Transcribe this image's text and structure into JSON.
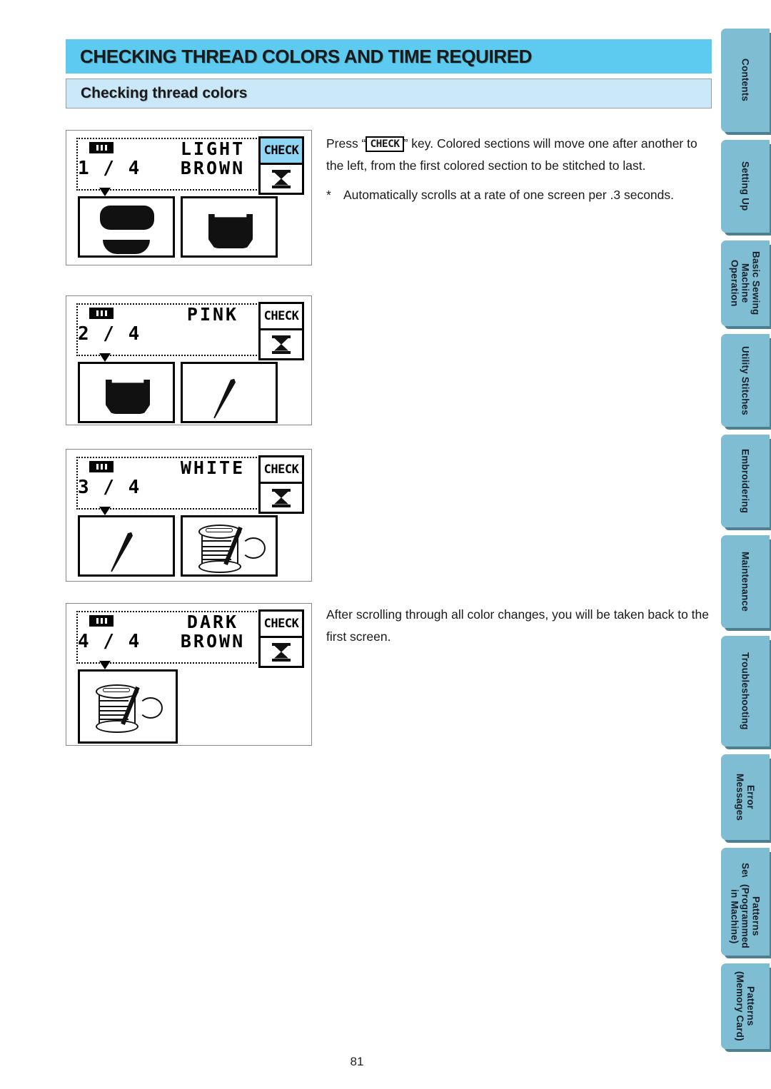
{
  "header": {
    "title": "CHECKING THREAD COLORS AND TIME REQUIRED",
    "section": "Checking thread colors",
    "title_bg": "#5ccbef",
    "section_bg": "#cbe8f9"
  },
  "paragraphs": {
    "p1_before": "Press “",
    "p1_key": "CHECK",
    "p1_after": "” key.  Colored sections will move one after another to the left, from the first colored section to be stitched to last.",
    "p2_marker": "*",
    "p2_text": "Automatically scrolls at a rate of one screen per .3 seconds.",
    "p3_text": "After scrolling through all color changes, you will be taken back to the first screen."
  },
  "lcd_screens": [
    {
      "index": "1",
      "fraction": "1 / 4",
      "color_name": "LIGHT\nBROWN",
      "check_label": "CHECK",
      "check_highlighted": true,
      "thumbnails": [
        "oval-and-arc-shape",
        "cup-shape"
      ]
    },
    {
      "index": "2",
      "fraction": "2 / 4",
      "color_name": "PINK",
      "check_label": "CHECK",
      "check_highlighted": false,
      "thumbnails": [
        "cup-shape",
        "needle-shape"
      ]
    },
    {
      "index": "3",
      "fraction": "3 / 4",
      "color_name": "WHITE",
      "check_label": "CHECK",
      "check_highlighted": false,
      "thumbnails": [
        "needle-shape",
        "spool-and-needle-shape"
      ]
    },
    {
      "index": "4",
      "fraction": "4 / 4",
      "color_name": "DARK\nBROWN",
      "check_label": "CHECK",
      "check_highlighted": false,
      "thumbnails": [
        "spool-and-needle-shape"
      ]
    }
  ],
  "side_tabs": [
    {
      "label": "Contents"
    },
    {
      "label": "Setting Up"
    },
    {
      "label": "Basic Sewing\nMachine\nOperation"
    },
    {
      "label": "Utility Stitches"
    },
    {
      "label": "Embroidering"
    },
    {
      "label": "Maintenance"
    },
    {
      "label": "Troubleshooting"
    },
    {
      "label": "Error\nMessages"
    },
    {
      "label": "Sewing Chart"
    },
    {
      "label": "Patterns\n(Programmed\nin Machine)"
    },
    {
      "label": "Patterns\n(Memory Card)"
    }
  ],
  "page_number": "81"
}
